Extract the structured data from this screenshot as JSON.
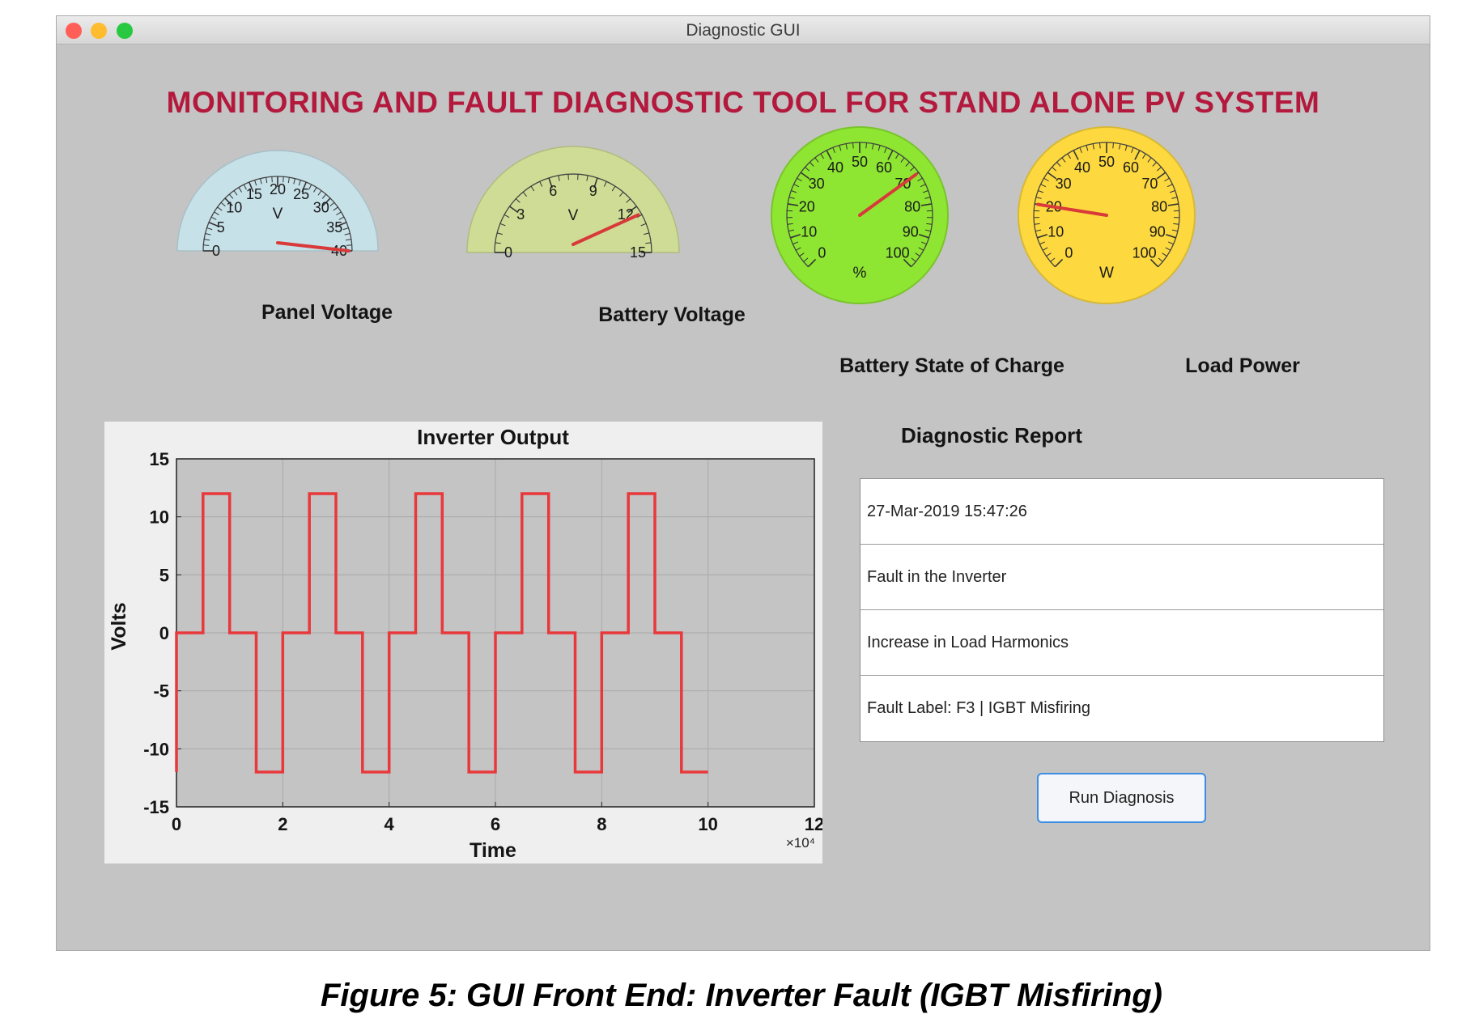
{
  "window": {
    "title": "Diagnostic GUI",
    "traffic_lights": [
      "#ff5f57",
      "#febc2e",
      "#28c840"
    ]
  },
  "app_heading": "MONITORING AND FAULT DIAGNOSTIC TOOL FOR STAND ALONE PV SYSTEM",
  "gauges": [
    {
      "label": "Panel Voltage",
      "unit": "V",
      "ticks": [
        "0",
        "5",
        "10",
        "15",
        "20",
        "25",
        "30",
        "35",
        "40"
      ],
      "min": 0,
      "max": 40,
      "value": 40,
      "face_color": "#c7e1e9"
    },
    {
      "label": "Battery Voltage",
      "unit": "V",
      "ticks": [
        "0",
        "3",
        "6",
        "9",
        "12",
        "15"
      ],
      "min": 0,
      "max": 15,
      "value": 12.5,
      "face_color": "#cfdc95"
    },
    {
      "label": "Battery State of Charge",
      "unit": "%",
      "ticks": [
        "0",
        "10",
        "20",
        "30",
        "40",
        "50",
        "60",
        "70",
        "80",
        "90",
        "100"
      ],
      "min": 0,
      "max": 100,
      "value": 70,
      "face_color": "#8ee632"
    },
    {
      "label": "Load Power",
      "unit": "W",
      "ticks": [
        "0",
        "10",
        "20",
        "30",
        "40",
        "50",
        "60",
        "70",
        "80",
        "90",
        "100"
      ],
      "min": 0,
      "max": 100,
      "value": 20,
      "face_color": "#fdd93f"
    }
  ],
  "chart_data": {
    "type": "line",
    "title": "Inverter Output",
    "xlabel": "Time",
    "ylabel": "Volts",
    "x_multiplier": "×10⁴",
    "xlim": [
      0,
      12
    ],
    "ylim": [
      -15,
      15
    ],
    "xticks": [
      "0",
      "2",
      "4",
      "6",
      "8",
      "10",
      "12"
    ],
    "yticks": [
      "15",
      "10",
      "5",
      "0",
      "-5",
      "-10",
      "-15"
    ],
    "grid": true,
    "line_color": "#e8383b",
    "series": [
      {
        "x": [
          0,
          0,
          0.5,
          0.5,
          1,
          1,
          1.5,
          1.5,
          2,
          2,
          2.5,
          2.5,
          3,
          3,
          3.5,
          3.5,
          4,
          4,
          4.5,
          4.5,
          5,
          5,
          5.5,
          5.5,
          6,
          6,
          6.5,
          6.5,
          7,
          7,
          7.5,
          7.5,
          8,
          8,
          8.5,
          8.5,
          9,
          9,
          9.5,
          9.5,
          10
        ],
        "values": [
          -12,
          0,
          0,
          12,
          12,
          0,
          0,
          -12,
          -12,
          0,
          0,
          12,
          12,
          0,
          0,
          -12,
          -12,
          0,
          0,
          12,
          12,
          0,
          0,
          -12,
          -12,
          0,
          0,
          12,
          12,
          0,
          0,
          -12,
          -12,
          0,
          0,
          12,
          12,
          0,
          0,
          -12,
          -12
        ]
      }
    ]
  },
  "report": {
    "heading": "Diagnostic Report",
    "lines": [
      "27-Mar-2019 15:47:26",
      "Fault in the Inverter",
      "Increase in Load Harmonics",
      "Fault Label: F3 | IGBT Misfiring"
    ]
  },
  "run_button": "Run Diagnosis",
  "caption": "Figure 5: GUI Front End: Inverter Fault (IGBT Misfiring)"
}
